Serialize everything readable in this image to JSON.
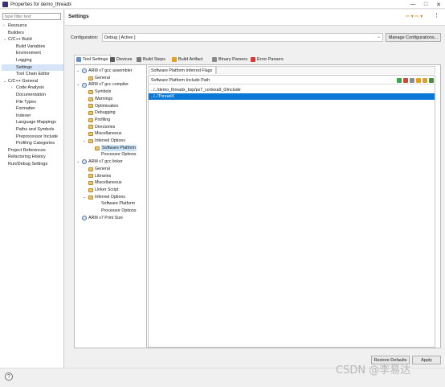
{
  "window": {
    "title": "Properties for demo_threadx",
    "buttons": [
      "—",
      "□",
      "✕"
    ]
  },
  "filter": {
    "placeholder": "type filter text"
  },
  "nav": {
    "items": [
      {
        "label": "Resource",
        "level": 0,
        "twisty": "›",
        "selected": false
      },
      {
        "label": "Builders",
        "level": 0,
        "twisty": "",
        "selected": false
      },
      {
        "label": "C/C++ Build",
        "level": 0,
        "twisty": "⌄",
        "selected": false
      },
      {
        "label": "Build Variables",
        "level": 1,
        "twisty": "",
        "selected": false
      },
      {
        "label": "Environment",
        "level": 1,
        "twisty": "",
        "selected": false
      },
      {
        "label": "Logging",
        "level": 1,
        "twisty": "",
        "selected": false
      },
      {
        "label": "Settings",
        "level": 1,
        "twisty": "",
        "selected": true
      },
      {
        "label": "Tool Chain Editor",
        "level": 1,
        "twisty": "",
        "selected": false
      },
      {
        "label": "C/C++ General",
        "level": 0,
        "twisty": "⌄",
        "selected": false
      },
      {
        "label": "Code Analysis",
        "level": 1,
        "twisty": "›",
        "selected": false
      },
      {
        "label": "Documentation",
        "level": 1,
        "twisty": "",
        "selected": false
      },
      {
        "label": "File Types",
        "level": 1,
        "twisty": "",
        "selected": false
      },
      {
        "label": "Formatter",
        "level": 1,
        "twisty": "",
        "selected": false
      },
      {
        "label": "Indexer",
        "level": 1,
        "twisty": "",
        "selected": false
      },
      {
        "label": "Language Mappings",
        "level": 1,
        "twisty": "",
        "selected": false
      },
      {
        "label": "Paths and Symbols",
        "level": 1,
        "twisty": "",
        "selected": false
      },
      {
        "label": "Preprocessor Include",
        "level": 1,
        "twisty": "",
        "selected": false
      },
      {
        "label": "Profiling Categories",
        "level": 1,
        "twisty": "",
        "selected": false
      },
      {
        "label": "Project References",
        "level": 0,
        "twisty": "",
        "selected": false
      },
      {
        "label": "Refactoring History",
        "level": 0,
        "twisty": "",
        "selected": false
      },
      {
        "label": "Run/Debug Settings",
        "level": 0,
        "twisty": "",
        "selected": false
      }
    ]
  },
  "header": {
    "title": "Settings",
    "nav_arrows": "⇦ ▾ ⇨ ▾",
    "menu": "⋮"
  },
  "configuration": {
    "label": "Configuration:",
    "value": "Debug  [ Active ]",
    "manage_label": "Manage Configurations..."
  },
  "tabs": [
    {
      "label": "Tool Settings",
      "selected": true,
      "color": "#6b8fc7"
    },
    {
      "label": "Devices",
      "selected": false,
      "color": "#5a5a5a"
    },
    {
      "label": "Build Steps",
      "selected": false,
      "color": "#7a7a7a"
    },
    {
      "label": "Build Artifact",
      "selected": false,
      "color": "#e2a31b"
    },
    {
      "label": "Binary Parsers",
      "selected": false,
      "color": "#8a8a8a"
    },
    {
      "label": "Error Parsers",
      "selected": false,
      "color": "#d33a2c"
    }
  ],
  "tool_tree": {
    "items": [
      {
        "label": "ARM v7 gcc assembler",
        "level": 0,
        "kind": "tool",
        "expanded": true,
        "selected": false
      },
      {
        "label": "General",
        "level": 1,
        "kind": "folder",
        "expanded": null,
        "selected": false
      },
      {
        "label": "ARM v7 gcc compiler",
        "level": 0,
        "kind": "tool",
        "expanded": true,
        "selected": false
      },
      {
        "label": "Symbols",
        "level": 1,
        "kind": "folder",
        "expanded": null,
        "selected": false
      },
      {
        "label": "Warnings",
        "level": 1,
        "kind": "folder",
        "expanded": null,
        "selected": false
      },
      {
        "label": "Optimization",
        "level": 1,
        "kind": "folder",
        "expanded": null,
        "selected": false
      },
      {
        "label": "Debugging",
        "level": 1,
        "kind": "folder",
        "expanded": null,
        "selected": false
      },
      {
        "label": "Profiling",
        "level": 1,
        "kind": "folder",
        "expanded": null,
        "selected": false
      },
      {
        "label": "Directories",
        "level": 1,
        "kind": "folder",
        "expanded": null,
        "selected": false
      },
      {
        "label": "Miscellaneous",
        "level": 1,
        "kind": "folder",
        "expanded": null,
        "selected": false
      },
      {
        "label": "Inferred Options",
        "level": 1,
        "kind": "folder",
        "expanded": true,
        "selected": false
      },
      {
        "label": "Software Platform",
        "level": 2,
        "kind": "folder",
        "expanded": null,
        "selected": true
      },
      {
        "label": "Processor Options",
        "level": 2,
        "kind": "none",
        "expanded": null,
        "selected": false
      },
      {
        "label": "ARM v7 gcc linker",
        "level": 0,
        "kind": "tool",
        "expanded": true,
        "selected": false
      },
      {
        "label": "General",
        "level": 1,
        "kind": "folder",
        "expanded": null,
        "selected": false
      },
      {
        "label": "Libraries",
        "level": 1,
        "kind": "folder",
        "expanded": null,
        "selected": false
      },
      {
        "label": "Miscellaneous",
        "level": 1,
        "kind": "folder",
        "expanded": null,
        "selected": false
      },
      {
        "label": "Linker Script",
        "level": 1,
        "kind": "folder",
        "expanded": null,
        "selected": false
      },
      {
        "label": "Inferred Options",
        "level": 1,
        "kind": "folder",
        "expanded": true,
        "selected": false
      },
      {
        "label": "Software Platform",
        "level": 2,
        "kind": "none",
        "expanded": null,
        "selected": false
      },
      {
        "label": "Processor Options",
        "level": 2,
        "kind": "none",
        "expanded": null,
        "selected": false
      },
      {
        "label": "ARM v7 Print Size",
        "level": 0,
        "kind": "tool",
        "expanded": null,
        "selected": false
      }
    ]
  },
  "panel": {
    "tab_label": "Software Platform Inferred Flags",
    "list_title": "Software Platform Include Path",
    "toolbar_icons": [
      {
        "name": "add-icon",
        "color": "#3aa64a"
      },
      {
        "name": "add-workspace-icon",
        "color": "#c94a3b"
      },
      {
        "name": "delete-icon",
        "color": "#8c8c8c"
      },
      {
        "name": "edit-icon",
        "color": "#e2a31b"
      },
      {
        "name": "move-up-icon",
        "color": "#d6a13a"
      },
      {
        "name": "move-down-icon",
        "color": "#4b8f3a"
      }
    ],
    "rows": [
      {
        "text": "../../demo_threadx_bsp/ps7_cortexa9_0/include",
        "selected": false
      },
      {
        "text": "../../ThreadX",
        "selected": true
      }
    ]
  },
  "buttons": {
    "restore": "Restore Defaults",
    "apply": "Apply"
  },
  "footer": {
    "help": "?",
    "watermark": "CSDN @李易达"
  }
}
